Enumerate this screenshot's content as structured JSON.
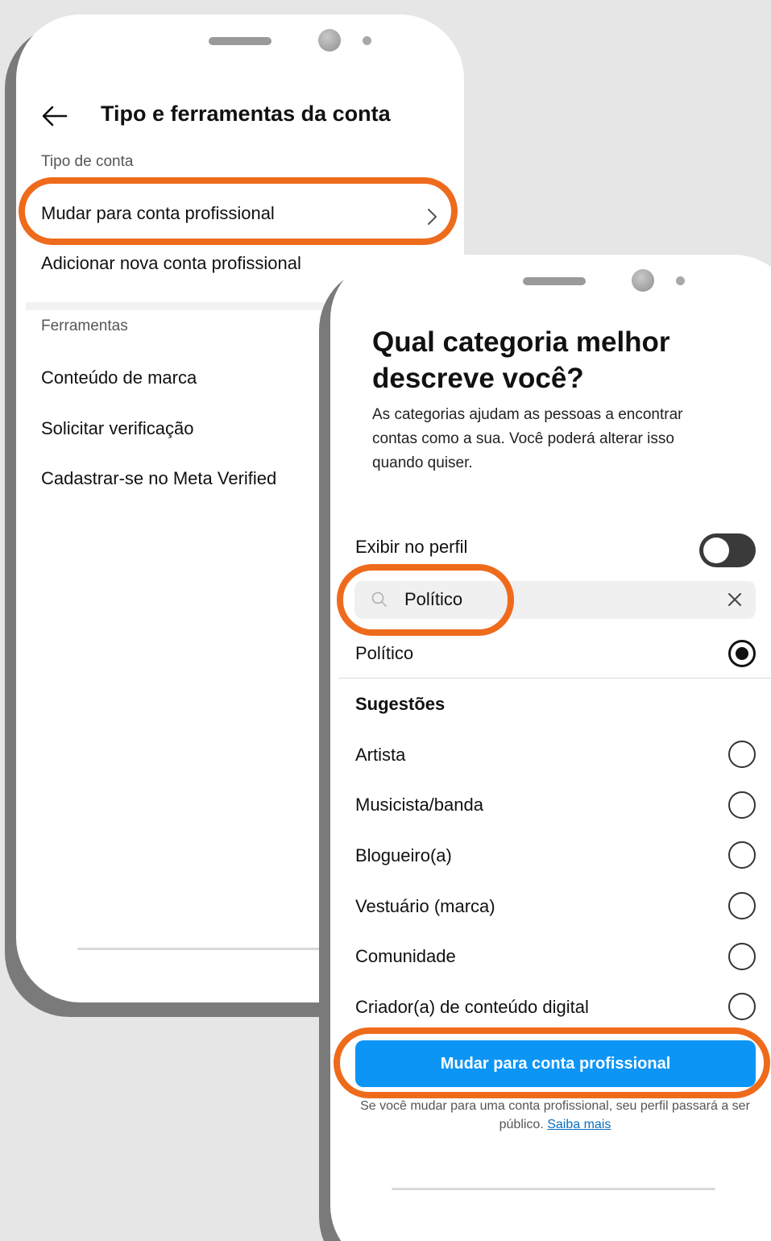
{
  "screen1": {
    "header": {
      "back_icon": "arrow-left-icon",
      "title": "Tipo e ferramentas da conta"
    },
    "account_type": {
      "label": "Tipo de conta",
      "items": [
        {
          "label": "Mudar para conta profissional",
          "icon": "chevron-right-icon"
        },
        {
          "label": "Adicionar nova conta profissional"
        }
      ]
    },
    "tools": {
      "label": "Ferramentas",
      "items": [
        {
          "label": "Conteúdo de marca"
        },
        {
          "label": "Solicitar verificação"
        },
        {
          "label": "Cadastrar-se no Meta Verified"
        }
      ]
    }
  },
  "screen2": {
    "heading": "Qual categoria melhor descreve você?",
    "subheading": "As categorias ajudam as pessoas a encontrar contas como a sua. Você poderá alterar isso quando quiser.",
    "display_on_profile": {
      "label": "Exibir no perfil",
      "enabled": false
    },
    "search": {
      "value": "Político",
      "icon": "search-icon",
      "clear_icon": "close-icon"
    },
    "selected": {
      "label": "Político",
      "checked": true
    },
    "suggestions": {
      "label": "Sugestões",
      "items": [
        {
          "label": "Artista",
          "checked": false
        },
        {
          "label": "Musicista/banda",
          "checked": false
        },
        {
          "label": "Blogueiro(a)",
          "checked": false
        },
        {
          "label": "Vestuário (marca)",
          "checked": false
        },
        {
          "label": "Comunidade",
          "checked": false
        },
        {
          "label": "Criador(a) de conteúdo digital",
          "checked": false
        }
      ]
    },
    "cta_label": "Mudar para conta profissional",
    "footnote_text": "Se você mudar para uma conta profissional, seu perfil passará a ser público.",
    "footnote_link": "Saiba mais"
  },
  "colors": {
    "highlight": "#ee6b1c",
    "button": "#0d95f6",
    "background": "#e6e6e6"
  }
}
